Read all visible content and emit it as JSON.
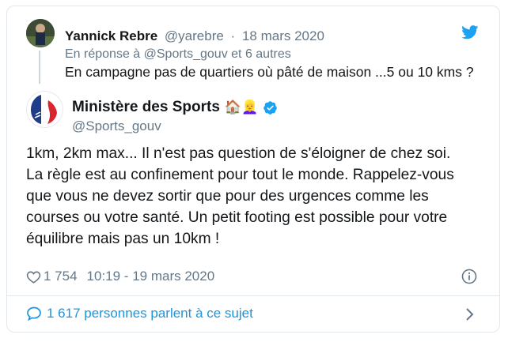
{
  "reply_tweet": {
    "author_name": "Yannick Rebre",
    "author_handle": "@yarebre",
    "separator": "·",
    "date": "18 mars 2020",
    "reply_context": "En réponse à @Sports_gouv et 6 autres",
    "text": "En campagne pas de quartiers où pâté de maison ...5 ou 10 kms ?"
  },
  "main_tweet": {
    "author_name": "Ministère des Sports",
    "name_emojis": "🏠👱‍♀️",
    "author_handle": "@Sports_gouv",
    "text_lines": [
      "1km, 2km max... Il n'est pas question de s'éloigner de chez soi.",
      "La règle est au confinement pour tout le monde. Rappelez-vous",
      "que vous ne devez sortir que pour des urgences comme les",
      "courses ou votre santé. Un petit footing est possible pour votre",
      "équilibre mais pas un 10km !"
    ],
    "likes": "1 754",
    "timestamp": "10:19 - 19 mars 2020"
  },
  "footer": {
    "conversation_label": "1 617 personnes parlent à ce sujet"
  },
  "icons": {
    "platform": "twitter-bird-icon",
    "verified": "verified-badge-icon",
    "like": "heart-icon",
    "info": "info-icon",
    "conversation": "speech-bubble-icon",
    "navigate": "chevron-right-icon"
  },
  "colors": {
    "brand_blue": "#1da1f2",
    "link_blue": "#1b95e0",
    "muted_text": "#657786",
    "primary_text": "#14171a",
    "border": "#e1e8ed"
  }
}
